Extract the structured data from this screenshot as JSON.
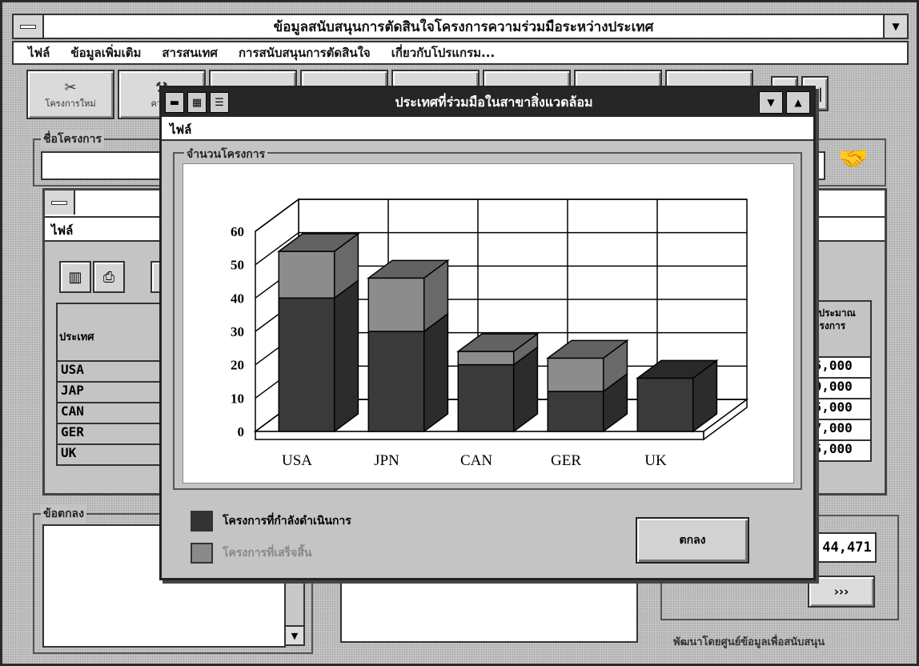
{
  "app": {
    "title": "ข้อมูลสนับสนุนการตัดสินใจโครงการความร่วมมือระหว่างประเทศ",
    "menu": [
      "ไฟล์",
      "ข้อมูลเพิ่มเติม",
      "สารสนเทศ",
      "การสนับสนุนการตัดสินใจ",
      "เกี่ยวกับโปรแกรม..."
    ],
    "toolbar": [
      "โครงการใหม่",
      "ความ"
    ],
    "nav_buttons": [
      "▶",
      "▶|"
    ],
    "project_name_label": "ชื่อโครงการ",
    "agreement_label": "ข้อตกลง",
    "more_button": "›››",
    "amount": "44,471",
    "footer": "พัฒนาโดยศูนย์ข้อมูลเพื่อสนับสนุน"
  },
  "sub_window": {
    "menu": "ไฟล์",
    "table_header": "ประเทศ",
    "countries": [
      "USA",
      "JAP",
      "CAN",
      "GER",
      "UK"
    ],
    "right_header": "งบประมาณโครงการ",
    "right_values": [
      "65,000",
      "70,000",
      "15,000",
      "87,000",
      "75,000"
    ]
  },
  "dialog": {
    "title": "ประเทศที่ร่วมมือในสาขาสิ่งแวดล้อม",
    "menu": "ไฟล์",
    "group_label": "จำนวนโครงการ",
    "ok_button": "ตกลง",
    "legend": [
      {
        "label": "โครงการที่กำลังดำเนินการ",
        "color": "#333333"
      },
      {
        "label": "โครงการที่เสร็จสิ้น",
        "color": "#8a8a8a"
      }
    ]
  },
  "chart_data": {
    "type": "bar",
    "stacked": true,
    "three_d": true,
    "categories": [
      "USA",
      "JPN",
      "CAN",
      "GER",
      "UK"
    ],
    "series": [
      {
        "name": "โครงการที่กำลังดำเนินการ",
        "color": "#3a3a3a",
        "values": [
          40,
          30,
          20,
          12,
          16
        ]
      },
      {
        "name": "โครงการที่เสร็จสิ้น",
        "color": "#8c8c8c",
        "values": [
          14,
          16,
          4,
          10,
          0
        ]
      }
    ],
    "yticks": [
      "0",
      "10",
      "20",
      "30",
      "40",
      "50",
      "60"
    ],
    "ylim": [
      0,
      60
    ],
    "grid": true
  }
}
